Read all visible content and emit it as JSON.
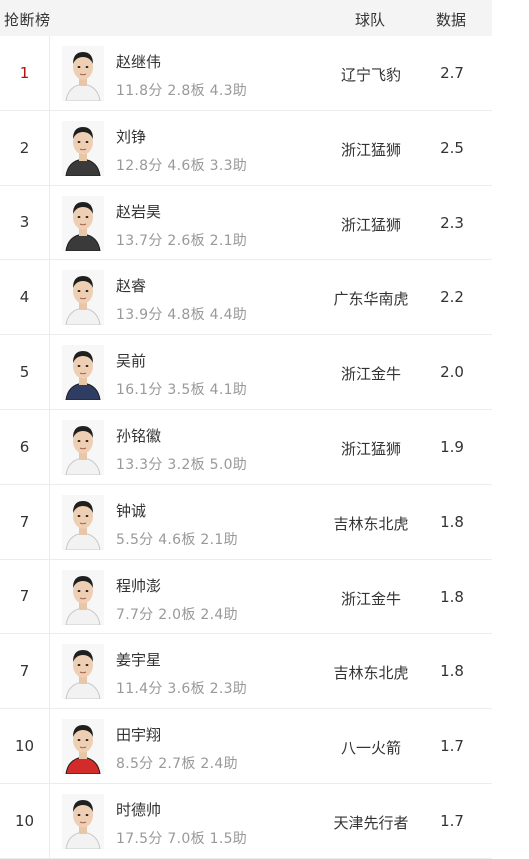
{
  "header": {
    "title": "抢断榜",
    "team_col": "球队",
    "stat_col": "数据"
  },
  "rows": [
    {
      "rank": "1",
      "name": "赵继伟",
      "line": "11.8分 2.8板 4.3助",
      "team": "辽宁飞豹",
      "stat": "2.7",
      "jersey": "white"
    },
    {
      "rank": "2",
      "name": "刘铮",
      "line": "12.8分 4.6板 3.3助",
      "team": "浙江猛狮",
      "stat": "2.5",
      "jersey": "dark"
    },
    {
      "rank": "3",
      "name": "赵岩昊",
      "line": "13.7分 2.6板 2.1助",
      "team": "浙江猛狮",
      "stat": "2.3",
      "jersey": "dark"
    },
    {
      "rank": "4",
      "name": "赵睿",
      "line": "13.9分 4.8板 4.4助",
      "team": "广东华南虎",
      "stat": "2.2",
      "jersey": "white"
    },
    {
      "rank": "5",
      "name": "吴前",
      "line": "16.1分 3.5板 4.1助",
      "team": "浙江金牛",
      "stat": "2.0",
      "jersey": "navy"
    },
    {
      "rank": "6",
      "name": "孙铭徽",
      "line": "13.3分 3.2板 5.0助",
      "team": "浙江猛狮",
      "stat": "1.9",
      "jersey": "white"
    },
    {
      "rank": "7",
      "name": "钟诚",
      "line": "5.5分 4.6板 2.1助",
      "team": "吉林东北虎",
      "stat": "1.8",
      "jersey": "white"
    },
    {
      "rank": "7",
      "name": "程帅澎",
      "line": "7.7分 2.0板 2.4助",
      "team": "浙江金牛",
      "stat": "1.8",
      "jersey": "white"
    },
    {
      "rank": "7",
      "name": "姜宇星",
      "line": "11.4分 3.6板 2.3助",
      "team": "吉林东北虎",
      "stat": "1.8",
      "jersey": "white"
    },
    {
      "rank": "10",
      "name": "田宇翔",
      "line": "8.5分 2.7板 2.4助",
      "team": "八一火箭",
      "stat": "1.7",
      "jersey": "red"
    },
    {
      "rank": "10",
      "name": "时德帅",
      "line": "17.5分 7.0板 1.5助",
      "team": "天津先行者",
      "stat": "1.7",
      "jersey": "white"
    }
  ],
  "colors": {
    "header_bg": "#f4f4f4",
    "rank_first": "#b40e0e",
    "secondary_text": "#999999",
    "jersey": {
      "white": "#f2f2f2",
      "dark": "#3a3a3a",
      "navy": "#2f3d63",
      "red": "#d32a2a"
    }
  }
}
